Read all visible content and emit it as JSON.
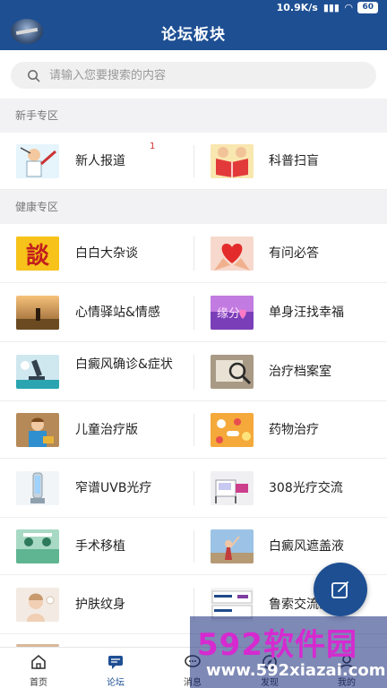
{
  "status_bar": {
    "speed": "10.9K/s",
    "battery": "60"
  },
  "header": {
    "title": "论坛板块"
  },
  "search": {
    "placeholder": "请输入您要搜索的内容"
  },
  "sections": [
    {
      "title": "新手专区"
    },
    {
      "title": "健康专区"
    }
  ],
  "forums": {
    "xinren": {
      "label": "新人报道",
      "badge": "1",
      "icon": "doctor-cartoon-thumb"
    },
    "kepu": {
      "label": "科普扫盲",
      "icon": "reading-book-thumb"
    },
    "baibai": {
      "label": "白白大杂谈",
      "icon": "talk-character-thumb"
    },
    "youwen": {
      "label": "有问必答",
      "icon": "heart-hands-thumb"
    },
    "xinqing": {
      "label": "心情驿站&情感",
      "icon": "sunset-person-thumb"
    },
    "danshen": {
      "label": "单身汪找幸福",
      "icon": "purple-love-thumb"
    },
    "queren": {
      "label": "白癜风确诊&症状",
      "icon": "microscope-thumb"
    },
    "dangan": {
      "label": "治疗档案室",
      "icon": "magnifier-file-thumb"
    },
    "ertong": {
      "label": "儿童治疗版",
      "icon": "child-thumb"
    },
    "yaowu": {
      "label": "药物治疗",
      "icon": "pills-thumb"
    },
    "uvb": {
      "label": "窄谱UVB光疗",
      "icon": "uvb-lamp-thumb"
    },
    "laser308": {
      "label": "308光疗交流",
      "icon": "laser-device-thumb"
    },
    "shoushu": {
      "label": "手术移植",
      "icon": "operating-room-thumb"
    },
    "zhegai": {
      "label": "白癜风遮盖液",
      "icon": "woman-sky-thumb"
    },
    "hufu": {
      "label": "护肤纹身",
      "icon": "skincare-thumb"
    },
    "lusuo": {
      "label": "鲁索交流区",
      "icon": "opzelura-box-thumb"
    }
  },
  "tabs": [
    {
      "label": "首页",
      "icon": "home-icon"
    },
    {
      "label": "论坛",
      "icon": "forum-icon"
    },
    {
      "label": "消息",
      "icon": "message-icon"
    },
    {
      "label": "发现",
      "icon": "discover-icon"
    },
    {
      "label": "我的",
      "icon": "profile-icon"
    }
  ],
  "watermark": {
    "brand": "592软件园",
    "url": "www.592xiazai.com"
  },
  "colors": {
    "brand": "#1e4f93",
    "section_bg": "#f2f2f4",
    "badge": "#d32f2f"
  }
}
